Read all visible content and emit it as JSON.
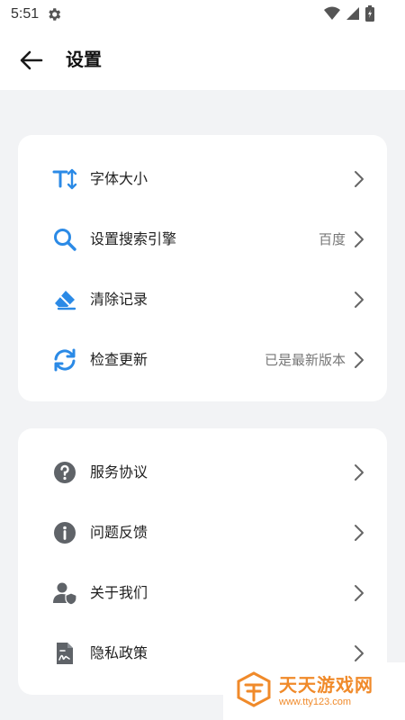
{
  "status_bar": {
    "time": "5:51"
  },
  "header": {
    "title": "设置"
  },
  "group1": [
    {
      "label": "字体大小",
      "value": "",
      "icon": "font-size-icon"
    },
    {
      "label": "设置搜索引擎",
      "value": "百度",
      "icon": "search-icon"
    },
    {
      "label": "清除记录",
      "value": "",
      "icon": "eraser-icon"
    },
    {
      "label": "检查更新",
      "value": "已是最新版本",
      "icon": "refresh-icon"
    }
  ],
  "group2": [
    {
      "label": "服务协议",
      "value": "",
      "icon": "question-icon"
    },
    {
      "label": "问题反馈",
      "value": "",
      "icon": "info-icon"
    },
    {
      "label": "关于我们",
      "value": "",
      "icon": "user-shield-icon"
    },
    {
      "label": "隐私政策",
      "value": "",
      "icon": "document-icon"
    }
  ],
  "watermark": {
    "title": "天天游戏网",
    "url": "www.tty123.com"
  },
  "colors": {
    "accent": "#2b8ae6",
    "gray_icon": "#5f6368",
    "watermark": "#f08a2a"
  }
}
